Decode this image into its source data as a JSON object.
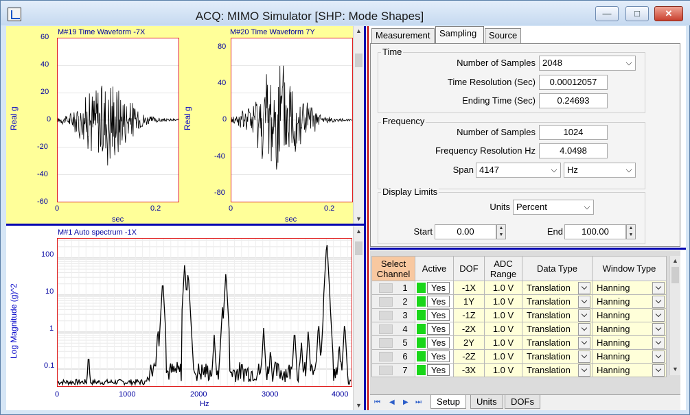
{
  "window": {
    "title": "ACQ: MIMO Simulator [SHP: Mode Shapes]",
    "min": "—",
    "max": "□",
    "close": "✕"
  },
  "plots": {
    "p1": {
      "title": "M#19 Time Waveform -7X",
      "ylabel": "Real g",
      "xlabel": "sec",
      "yticks": [
        "60",
        "40",
        "20",
        "0",
        "-20",
        "-40",
        "-60"
      ],
      "xticks": [
        "0",
        "0.2"
      ]
    },
    "p2": {
      "title": "M#20 Time Waveform 7Y",
      "ylabel": "Real g",
      "xlabel": "sec",
      "yticks": [
        "80",
        "40",
        "0",
        "-40",
        "-80"
      ],
      "xticks": [
        "0",
        "0.2"
      ]
    },
    "p3": {
      "title": "M#1 Auto spectrum -1X",
      "ylabel": "Log Magnitude (g)^2",
      "xlabel": "Hz",
      "yticks": [
        "100",
        "10",
        "1",
        "0.1"
      ],
      "xticks": [
        "0",
        "1000",
        "2000",
        "3000",
        "4000"
      ]
    }
  },
  "tabs": [
    "Measurement",
    "Sampling",
    "Source"
  ],
  "sampling": {
    "time_group": "Time",
    "num_samples_label": "Number of Samples",
    "num_samples": "2048",
    "time_res_label": "Time Resolution (Sec)",
    "time_res": "0.00012057",
    "end_time_label": "Ending Time (Sec)",
    "end_time": "0.24693",
    "freq_group": "Frequency",
    "freq_samples_label": "Number of Samples",
    "freq_samples": "1024",
    "freq_res_label": "Frequency Resolution Hz",
    "freq_res": "4.0498",
    "span_label": "Span",
    "span": "4147",
    "span_unit": "Hz",
    "display_group": "Display Limits",
    "units_label": "Units",
    "units": "Percent",
    "start_label": "Start",
    "start": "0.00",
    "end_label": "End",
    "end": "100.00"
  },
  "grid": {
    "headers": [
      "Select Channel",
      "Active",
      "DOF",
      "ADC Range",
      "Data Type",
      "Window Type"
    ],
    "rows": [
      {
        "ch": "1",
        "active": "Yes",
        "dof": "-1X",
        "adc": "1.0 V",
        "dtype": "Translation",
        "win": "Hanning"
      },
      {
        "ch": "2",
        "active": "Yes",
        "dof": "1Y",
        "adc": "1.0 V",
        "dtype": "Translation",
        "win": "Hanning"
      },
      {
        "ch": "3",
        "active": "Yes",
        "dof": "-1Z",
        "adc": "1.0 V",
        "dtype": "Translation",
        "win": "Hanning"
      },
      {
        "ch": "4",
        "active": "Yes",
        "dof": "-2X",
        "adc": "1.0 V",
        "dtype": "Translation",
        "win": "Hanning"
      },
      {
        "ch": "5",
        "active": "Yes",
        "dof": "2Y",
        "adc": "1.0 V",
        "dtype": "Translation",
        "win": "Hanning"
      },
      {
        "ch": "6",
        "active": "Yes",
        "dof": "-2Z",
        "adc": "1.0 V",
        "dtype": "Translation",
        "win": "Hanning"
      },
      {
        "ch": "7",
        "active": "Yes",
        "dof": "-3X",
        "adc": "1.0 V",
        "dtype": "Translation",
        "win": "Hanning"
      }
    ],
    "hscroll_glyph": "|||"
  },
  "bottom_tabs": [
    "Setup",
    "Units",
    "DOFs"
  ]
}
